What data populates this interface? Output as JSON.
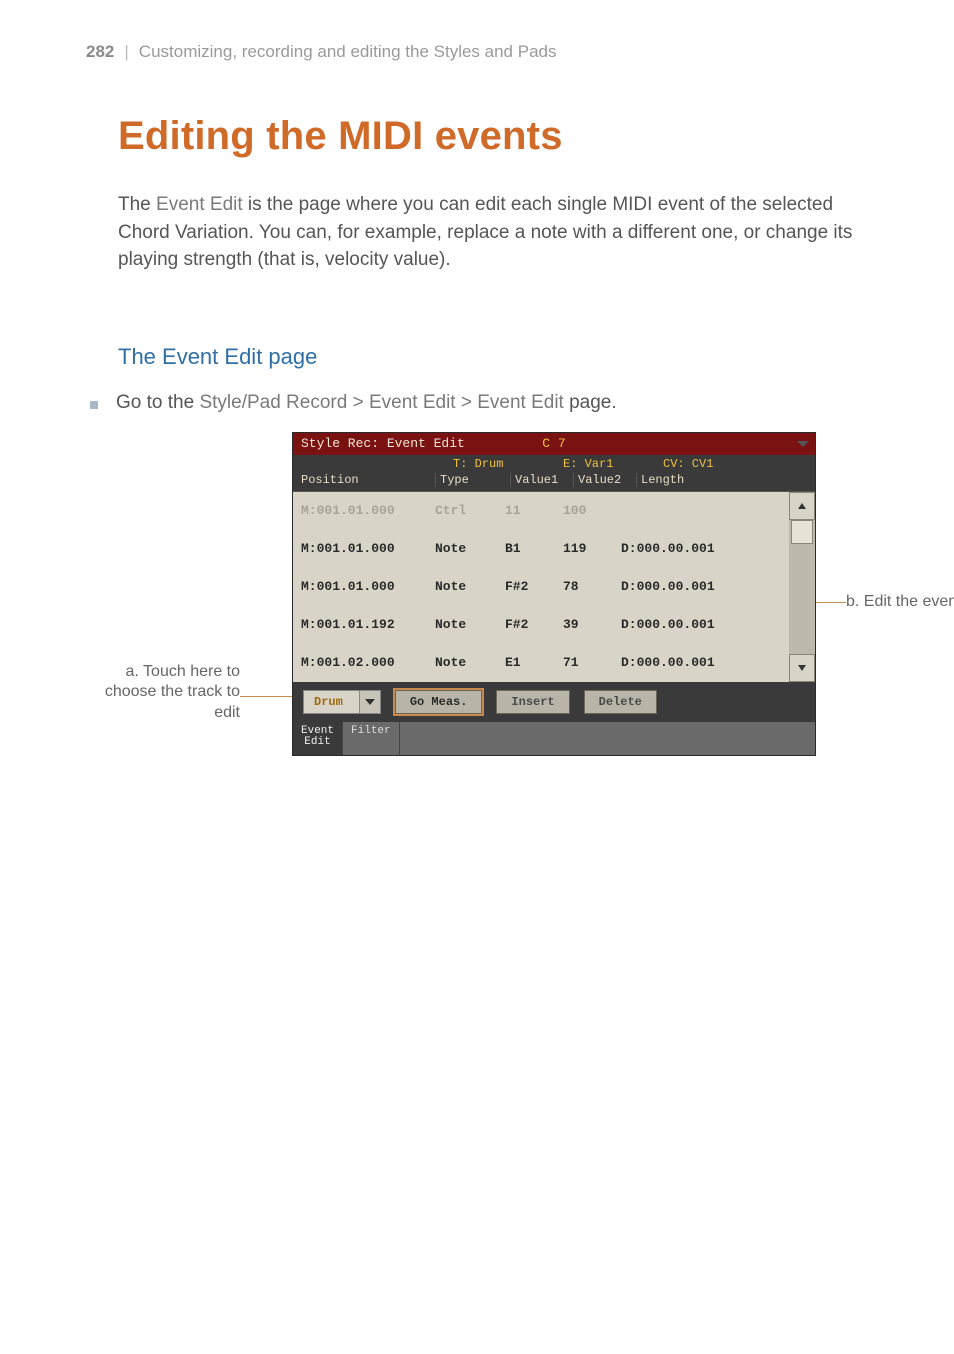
{
  "running_head": {
    "page_number": "282",
    "separator": "|",
    "section_title": "Customizing, recording and editing the Styles and Pads"
  },
  "heading1": "Editing the MIDI events",
  "intro": {
    "pre": "The ",
    "kw": "Event Edit",
    "post": " is the page where you can edit each single MIDI event of the selected Chord Variation. You can, for example, replace a note with a different one, or change its playing strength (that is, velocity value)."
  },
  "heading2": "The Event Edit page",
  "step": {
    "pre": "Go to the ",
    "kw": "Style/Pad Record > Event Edit > Event Edit",
    "post": " page."
  },
  "callouts": {
    "left": "a. Touch here to choose the track to edit",
    "right": "b. Edit the events"
  },
  "screen": {
    "title": "Style Rec: Event Edit",
    "chord": "C 7",
    "info": {
      "t": "T: Drum",
      "e": "E: Var1",
      "cv": "CV: CV1"
    },
    "headers": {
      "position": "Position",
      "type": "Type",
      "v1": "Value1",
      "v2": "Value2",
      "length": "Length"
    },
    "rows": [
      {
        "dim": true,
        "pos": "M:001.01.000",
        "type": "Ctrl",
        "v1": "11",
        "v2": "100",
        "len": ""
      },
      {
        "dim": false,
        "pos": "M:001.01.000",
        "type": "Note",
        "v1": "B1",
        "v2": "119",
        "len": "D:000.00.001"
      },
      {
        "dim": false,
        "pos": "M:001.01.000",
        "type": "Note",
        "v1": "F#2",
        "v2": "78",
        "len": "D:000.00.001"
      },
      {
        "dim": false,
        "pos": "M:001.01.192",
        "type": "Note",
        "v1": "F#2",
        "v2": "39",
        "len": "D:000.00.001"
      },
      {
        "dim": false,
        "pos": "M:001.02.000",
        "type": "Note",
        "v1": "E1",
        "v2": "71",
        "len": "D:000.00.001"
      }
    ],
    "track_dropdown": "Drum",
    "buttons": {
      "go": "Go Meas.",
      "insert": "Insert",
      "delete": "Delete"
    },
    "tabs": {
      "event_edit_l1": "Event",
      "event_edit_l2": "Edit",
      "filter": "Filter"
    }
  }
}
